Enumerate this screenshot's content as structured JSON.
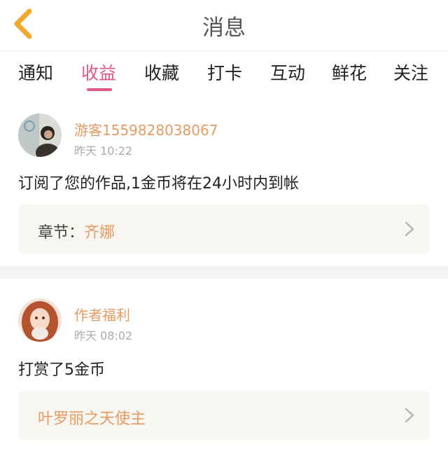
{
  "header": {
    "title": "消息",
    "back_icon": "chevron-left-icon",
    "accent_color": "#f0a92a"
  },
  "tabs": [
    {
      "label": "通知"
    },
    {
      "label": "收益",
      "active": true
    },
    {
      "label": "收藏"
    },
    {
      "label": "打卡"
    },
    {
      "label": "互动"
    },
    {
      "label": "鲜花"
    },
    {
      "label": "关注"
    }
  ],
  "messages": [
    {
      "user": "游客1559828038067",
      "time": "昨天 10:22",
      "content": "订阅了您的作品,1金币将在24小时内到帐",
      "link_prefix": "章节：",
      "link_value": "齐娜"
    },
    {
      "user": "作者福利",
      "time": "昨天 08:02",
      "content": "打赏了5金币",
      "link_prefix": "",
      "link_value": "叶罗丽之天使主"
    }
  ],
  "colors": {
    "active_tab": "#e4568a",
    "username": "#e59a62",
    "link_box_bg": "#f7f6f1"
  }
}
